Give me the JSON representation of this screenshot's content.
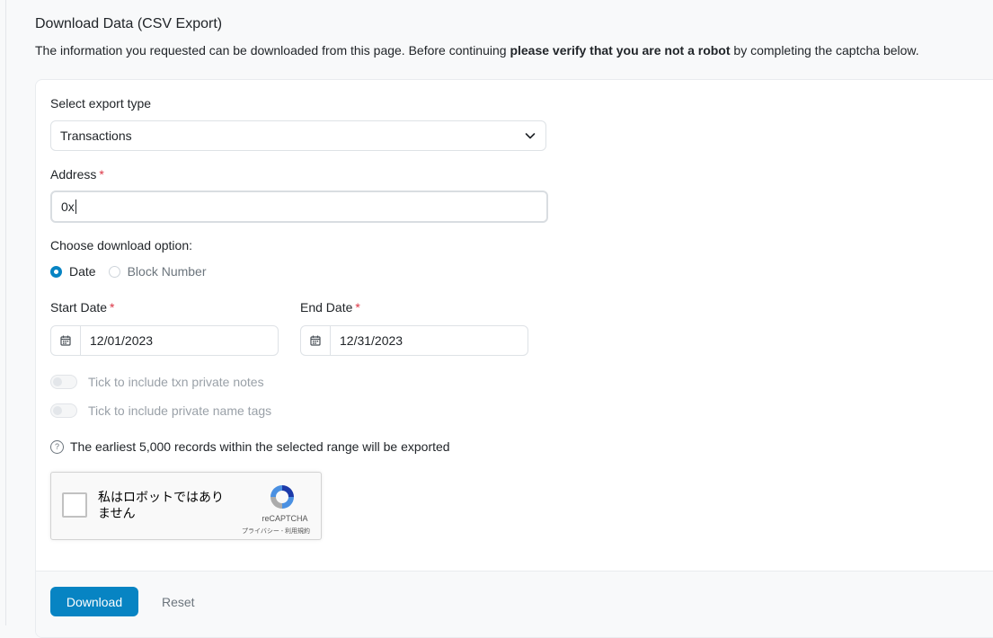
{
  "page": {
    "title": "Download Data (CSV Export)",
    "desc_before": "The information you requested can be downloaded from this page. Before continuing ",
    "desc_bold": "please verify that you are not a robot",
    "desc_after": " by completing the captcha below."
  },
  "form": {
    "export_type_label": "Select export type",
    "export_type_value": "Transactions",
    "address_label": "Address",
    "address_value": "0x",
    "required_mark": "*",
    "download_option_label": "Choose download option:",
    "option_date": "Date",
    "option_block": "Block Number",
    "start_date_label": "Start Date",
    "start_date_value": "12/01/2023",
    "end_date_label": "End Date",
    "end_date_value": "12/31/2023",
    "toggle_notes_label": "Tick to include txn private notes",
    "toggle_tags_label": "Tick to include private name tags",
    "note_text": "The earliest 5,000 records within the selected range will be exported",
    "note_icon": "?"
  },
  "captcha": {
    "checkbox_label": "私はロボットではありません",
    "brand": "reCAPTCHA",
    "links": "プライバシー - 利用規約"
  },
  "actions": {
    "download_label": "Download",
    "reset_label": "Reset"
  },
  "colors": {
    "primary": "#0784c3",
    "required": "#dc3545"
  }
}
